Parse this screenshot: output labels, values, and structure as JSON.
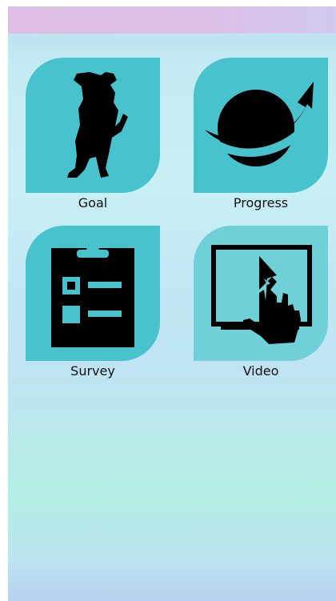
{
  "tiles": [
    {
      "label": "Goal",
      "icon": "stretching-person-icon"
    },
    {
      "label": "Progress",
      "icon": "planet-arrow-icon"
    },
    {
      "label": "Survey",
      "icon": "clipboard-checklist-icon"
    },
    {
      "label": "Video",
      "icon": "touch-screen-play-icon"
    }
  ],
  "colors": {
    "header": "#e0bde6",
    "tile": "#48c2cc",
    "tile_video": "#6fd0d8",
    "icon": "#000000"
  }
}
